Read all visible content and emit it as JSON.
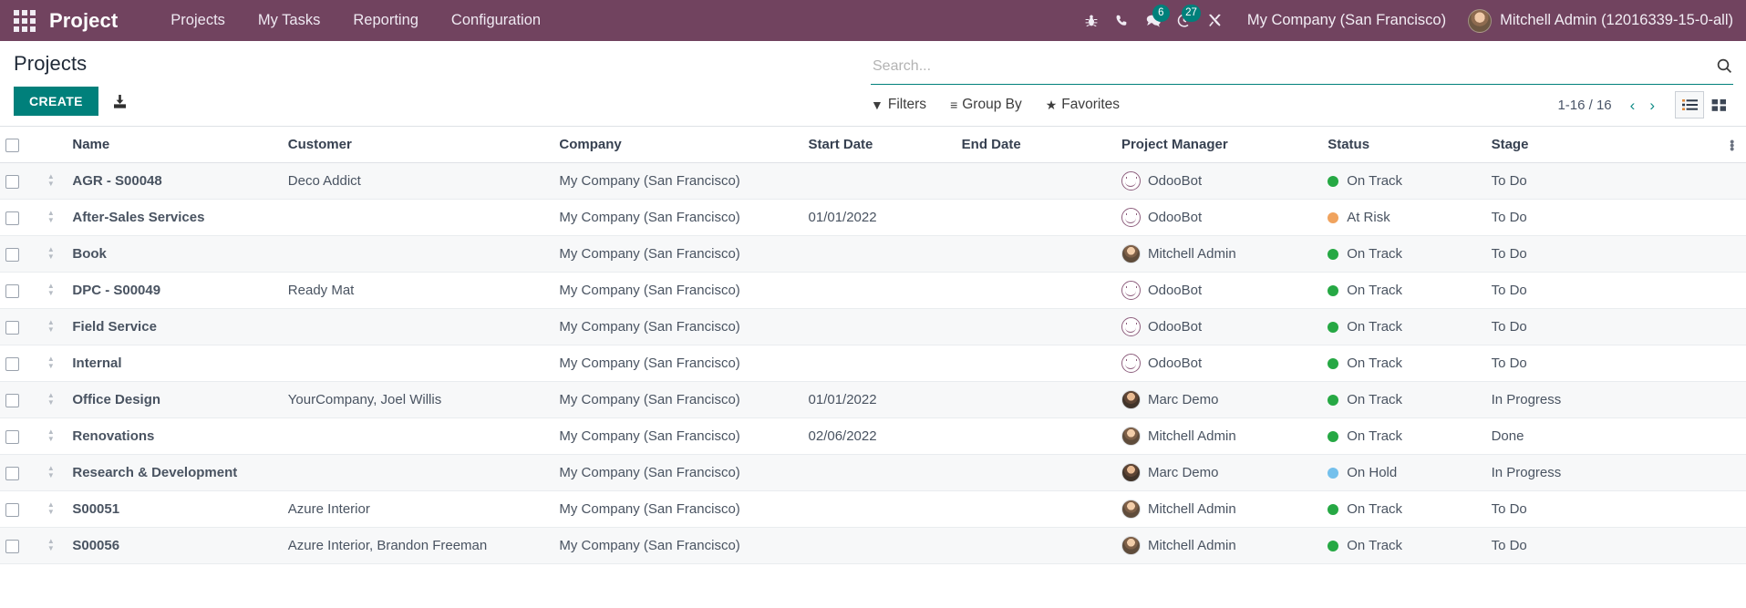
{
  "navbar": {
    "apps_icon": "apps-grid-icon",
    "brand": "Project",
    "menu_items": [
      {
        "label": "Projects"
      },
      {
        "label": "My Tasks"
      },
      {
        "label": "Reporting"
      },
      {
        "label": "Configuration"
      }
    ],
    "sys_icons": [
      {
        "name": "bug-icon",
        "badge": null
      },
      {
        "name": "phone-icon",
        "badge": null
      },
      {
        "name": "messages-icon",
        "badge": "6"
      },
      {
        "name": "activities-clock-icon",
        "badge": "27"
      },
      {
        "name": "tools-icon",
        "badge": null
      }
    ],
    "company": "My Company (San Francisco)",
    "user": "Mitchell Admin (12016339-15-0-all)",
    "bg_color": "#71435f",
    "badge_color": "#00807b"
  },
  "control_panel": {
    "title": "Projects",
    "create_label": "CREATE",
    "create_color": "#00807b",
    "upload_icon": "import-upload-icon",
    "search": {
      "placeholder": "Search...",
      "value": "",
      "icon": "search-icon"
    },
    "filter_buttons": [
      {
        "label": "Filters",
        "glyph": "▼",
        "icon": "filter-icon"
      },
      {
        "label": "Group By",
        "glyph": "≡",
        "icon": "group-by-icon"
      },
      {
        "label": "Favorites",
        "glyph": "★",
        "icon": "star-icon"
      }
    ],
    "pager": "1-16 / 16",
    "prev_icon": "‹",
    "next_icon": "›",
    "views": [
      {
        "name": "list-view",
        "active": true
      },
      {
        "name": "kanban-view",
        "active": false
      }
    ]
  },
  "table": {
    "columns": [
      {
        "key": "name",
        "label": "Name"
      },
      {
        "key": "customer",
        "label": "Customer"
      },
      {
        "key": "company",
        "label": "Company"
      },
      {
        "key": "start_date",
        "label": "Start Date"
      },
      {
        "key": "end_date",
        "label": "End Date"
      },
      {
        "key": "project_manager",
        "label": "Project Manager"
      },
      {
        "key": "status",
        "label": "Status"
      },
      {
        "key": "stage",
        "label": "Stage"
      }
    ],
    "options_icon": "column-options-icon",
    "status_colors": {
      "On Track": "#26a844",
      "At Risk": "#f0a35e",
      "On Hold": "#74c0ec"
    },
    "rows": [
      {
        "name": "AGR - S00048",
        "customer": "Deco Addict",
        "company": "My Company (San Francisco)",
        "start_date": "",
        "end_date": "",
        "project_manager": "OdooBot",
        "pm_avatar": "bot",
        "status": "On Track",
        "stage": "To Do"
      },
      {
        "name": "After-Sales Services",
        "customer": "",
        "company": "My Company (San Francisco)",
        "start_date": "01/01/2022",
        "end_date": "",
        "project_manager": "OdooBot",
        "pm_avatar": "bot",
        "status": "At Risk",
        "stage": "To Do"
      },
      {
        "name": "Book",
        "customer": "",
        "company": "My Company (San Francisco)",
        "start_date": "",
        "end_date": "",
        "project_manager": "Mitchell Admin",
        "pm_avatar": "mitchell",
        "status": "On Track",
        "stage": "To Do"
      },
      {
        "name": "DPC - S00049",
        "customer": "Ready Mat",
        "company": "My Company (San Francisco)",
        "start_date": "",
        "end_date": "",
        "project_manager": "OdooBot",
        "pm_avatar": "bot",
        "status": "On Track",
        "stage": "To Do"
      },
      {
        "name": "Field Service",
        "customer": "",
        "company": "My Company (San Francisco)",
        "start_date": "",
        "end_date": "",
        "project_manager": "OdooBot",
        "pm_avatar": "bot",
        "status": "On Track",
        "stage": "To Do"
      },
      {
        "name": "Internal",
        "customer": "",
        "company": "My Company (San Francisco)",
        "start_date": "",
        "end_date": "",
        "project_manager": "OdooBot",
        "pm_avatar": "bot",
        "status": "On Track",
        "stage": "To Do"
      },
      {
        "name": "Office Design",
        "customer": "YourCompany, Joel Willis",
        "company": "My Company (San Francisco)",
        "start_date": "01/01/2022",
        "end_date": "",
        "project_manager": "Marc Demo",
        "pm_avatar": "marc",
        "status": "On Track",
        "stage": "In Progress"
      },
      {
        "name": "Renovations",
        "customer": "",
        "company": "My Company (San Francisco)",
        "start_date": "02/06/2022",
        "end_date": "",
        "project_manager": "Mitchell Admin",
        "pm_avatar": "mitchell",
        "status": "On Track",
        "stage": "Done"
      },
      {
        "name": "Research & Development",
        "customer": "",
        "company": "My Company (San Francisco)",
        "start_date": "",
        "end_date": "",
        "project_manager": "Marc Demo",
        "pm_avatar": "marc",
        "status": "On Hold",
        "stage": "In Progress"
      },
      {
        "name": "S00051",
        "customer": "Azure Interior",
        "company": "My Company (San Francisco)",
        "start_date": "",
        "end_date": "",
        "project_manager": "Mitchell Admin",
        "pm_avatar": "mitchell",
        "status": "On Track",
        "stage": "To Do"
      },
      {
        "name": "S00056",
        "customer": "Azure Interior, Brandon Freeman",
        "company": "My Company (San Francisco)",
        "start_date": "",
        "end_date": "",
        "project_manager": "Mitchell Admin",
        "pm_avatar": "mitchell",
        "status": "On Track",
        "stage": "To Do"
      }
    ]
  }
}
